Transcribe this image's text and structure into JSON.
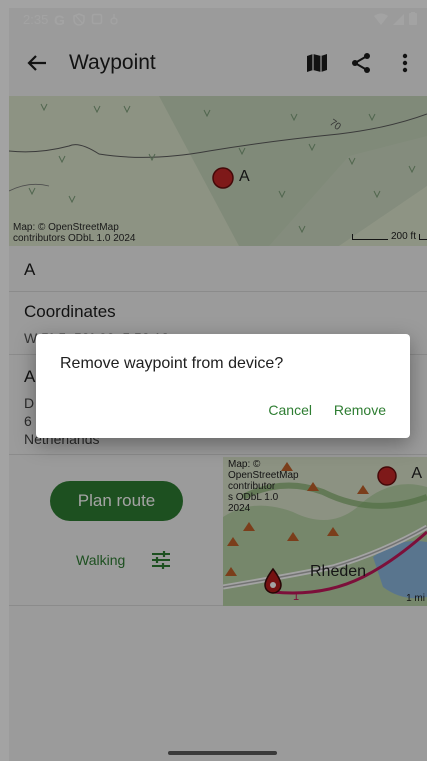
{
  "status_bar": {
    "time": "2:35"
  },
  "app_bar": {
    "title": "Waypoint"
  },
  "map": {
    "attribution_line1": "Map: © OpenStreetMap",
    "attribution_line2": "contributors ODbL 1.0 2024",
    "scale": "200 ft",
    "marker_label": "A",
    "contour_label": "70"
  },
  "detail": {
    "name": "A",
    "coordinates_label": "Coordinates",
    "coordinates_value": "W 5° 5. 52° 00. 5 52 12",
    "address_label": "A",
    "address_line1": "D",
    "address_line2": "6",
    "address_line3": "Netherlands"
  },
  "actions": {
    "plan_route": "Plan route",
    "mode": "Walking"
  },
  "minimap": {
    "attribution_lines": [
      "Map: ©",
      "OpenStreetMap",
      "contributor",
      "s ODbL 1.0",
      "2024"
    ],
    "place": "Rheden",
    "marker_label": "A",
    "scale": "1 mi",
    "route_label": "1"
  },
  "dialog": {
    "message": "Remove waypoint from device?",
    "cancel": "Cancel",
    "remove": "Remove"
  },
  "colors": {
    "accent": "#2e7d32",
    "marker": "#c62828"
  }
}
